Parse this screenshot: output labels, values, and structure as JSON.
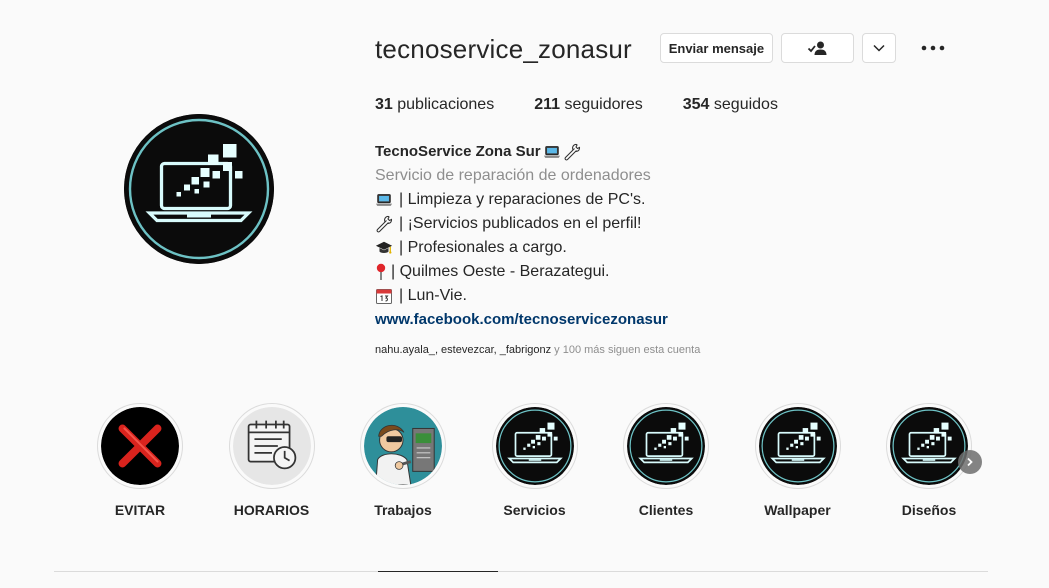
{
  "profile": {
    "username": "tecnoservice_zonasur",
    "send_message_label": "Enviar mensaje",
    "follow_icon": "person-check-icon",
    "more_icon": "ellipsis-icon",
    "stats": {
      "posts_count": "31",
      "posts_label": "publicaciones",
      "followers_count": "211",
      "followers_label": "seguidores",
      "following_count": "354",
      "following_label": "seguidos"
    },
    "bio": {
      "name": "TecnoService Zona Sur",
      "category": "Servicio de reparación de ordenadores",
      "lines": [
        "| Limpieza y reparaciones de PC's.",
        "| ¡Servicios publicados en el perfil!",
        "| Profesionales a cargo.",
        "| Quilmes Oeste - Berazategui.",
        "| Lun-Vie."
      ],
      "link": "www.facebook.com/tecnoservicezonasur"
    },
    "followed_by": {
      "names": "nahu.ayala_, estevezcar, _fabrigonz",
      "rest": " y 100 más siguen esta cuenta"
    }
  },
  "highlights": [
    {
      "label": "EVITAR",
      "icon": "red-x-icon"
    },
    {
      "label": "HORARIOS",
      "icon": "calendar-clock-icon"
    },
    {
      "label": "Trabajos",
      "icon": "technician-icon"
    },
    {
      "label": "Servicios",
      "icon": "laptop-logo-icon"
    },
    {
      "label": "Clientes",
      "icon": "laptop-logo-icon"
    },
    {
      "label": "Wallpaper",
      "icon": "laptop-logo-icon"
    },
    {
      "label": "Diseños",
      "icon": "laptop-logo-icon"
    }
  ],
  "colors": {
    "link": "#00376b",
    "muted": "#8e8e8e",
    "text": "#262626",
    "glow": "#7fe3e6"
  }
}
